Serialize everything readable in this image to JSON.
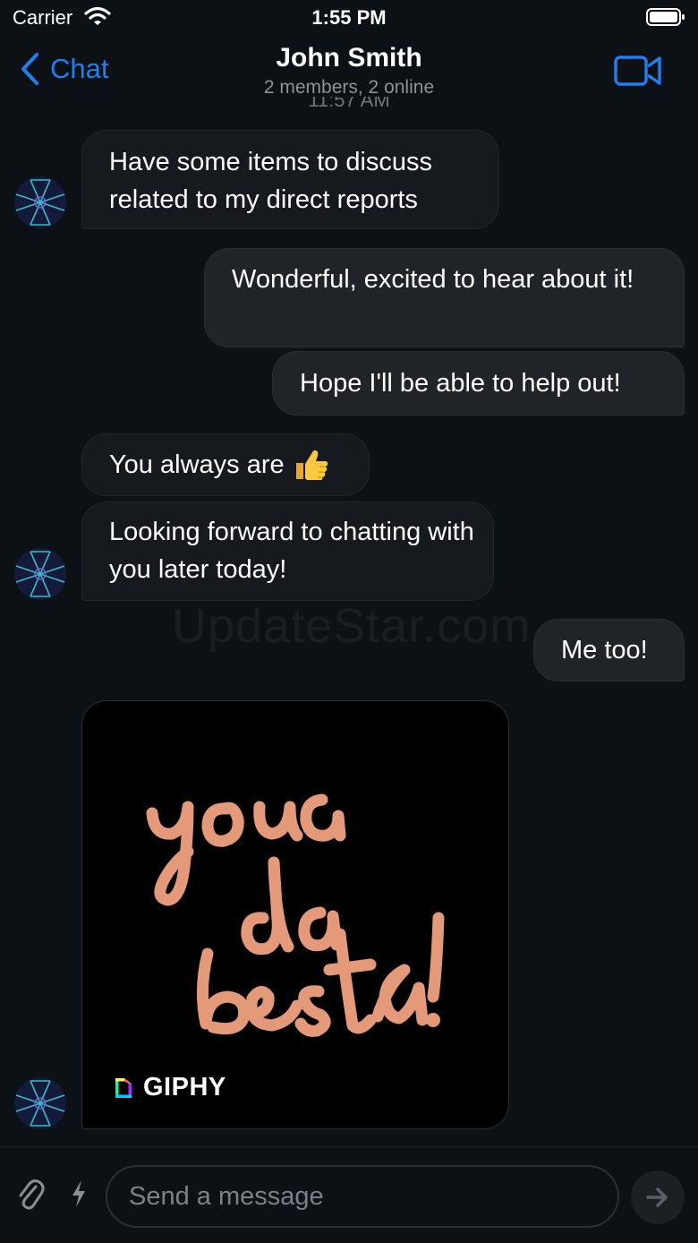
{
  "status_bar": {
    "carrier": "Carrier",
    "time": "1:55 PM"
  },
  "header": {
    "back_label": "Chat",
    "title": "John Smith",
    "subtitle": "2 members, 2 online",
    "back_icon": "chevron-left-icon",
    "action_icon": "video-camera-icon",
    "accent_color": "#1f7ef0"
  },
  "messages": [
    {
      "side": "incoming",
      "text": "Have some items to discuss related to my direct reports"
    },
    {
      "side": "outgoing",
      "text": "Wonderful, excited to hear about it!"
    },
    {
      "side": "outgoing",
      "text": "Hope I'll be able to help out!"
    },
    {
      "side": "incoming",
      "text": "You always are",
      "emoji": "👍"
    },
    {
      "side": "incoming",
      "text": "Looking forward to chatting with you later today!"
    },
    {
      "side": "outgoing",
      "text": "Me too!"
    }
  ],
  "giphy": {
    "brand": "GIPHY",
    "art_text": "you da best!"
  },
  "watermark": "UpdateStar.com",
  "composer": {
    "placeholder": "Send a message",
    "attach_icon": "paperclip-icon",
    "commands_icon": "lightning-bolt-icon",
    "send_icon": "arrow-right-icon"
  }
}
